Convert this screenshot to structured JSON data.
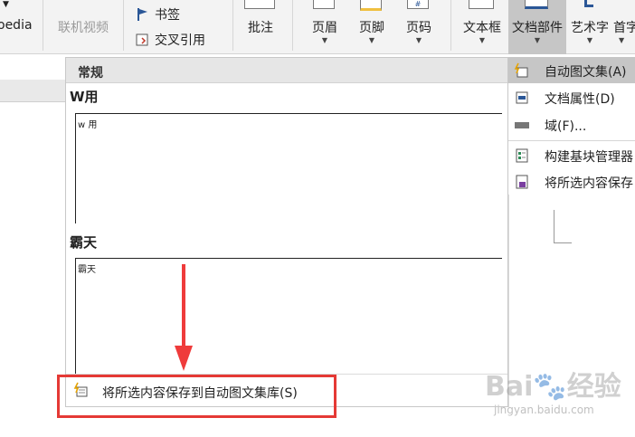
{
  "ribbon": {
    "pedia_label": "oedia",
    "online_video_label": "联机视频",
    "bookmark_label": "书签",
    "cross_ref_label": "交叉引用",
    "comment_label": "批注",
    "header_label": "页眉",
    "footer_label": "页脚",
    "page_number_label": "页码",
    "textbox_label": "文本框",
    "doc_parts_label": "文档部件",
    "wordart_label": "艺术字",
    "dropcap_label": "首字"
  },
  "gallery": {
    "category": "常规",
    "entries": [
      {
        "title": "W用",
        "preview": "w 用"
      },
      {
        "title": "霸天",
        "preview": "霸天"
      }
    ],
    "footer_action": "将所选内容保存到自动图文集库(S)"
  },
  "menu": {
    "items": [
      {
        "label": "自动图文集(A)",
        "active": true
      },
      {
        "label": "文档属性(D)"
      },
      {
        "label": "域(F)..."
      },
      {
        "label": "构建基块管理器"
      },
      {
        "label": "将所选内容保存"
      }
    ]
  },
  "watermark": {
    "line1": "Bai🐾经验",
    "line2": "jingyan.baidu.com"
  },
  "colors": {
    "annotation_red": "#e53935",
    "active_gray": "#c6c6c6"
  }
}
